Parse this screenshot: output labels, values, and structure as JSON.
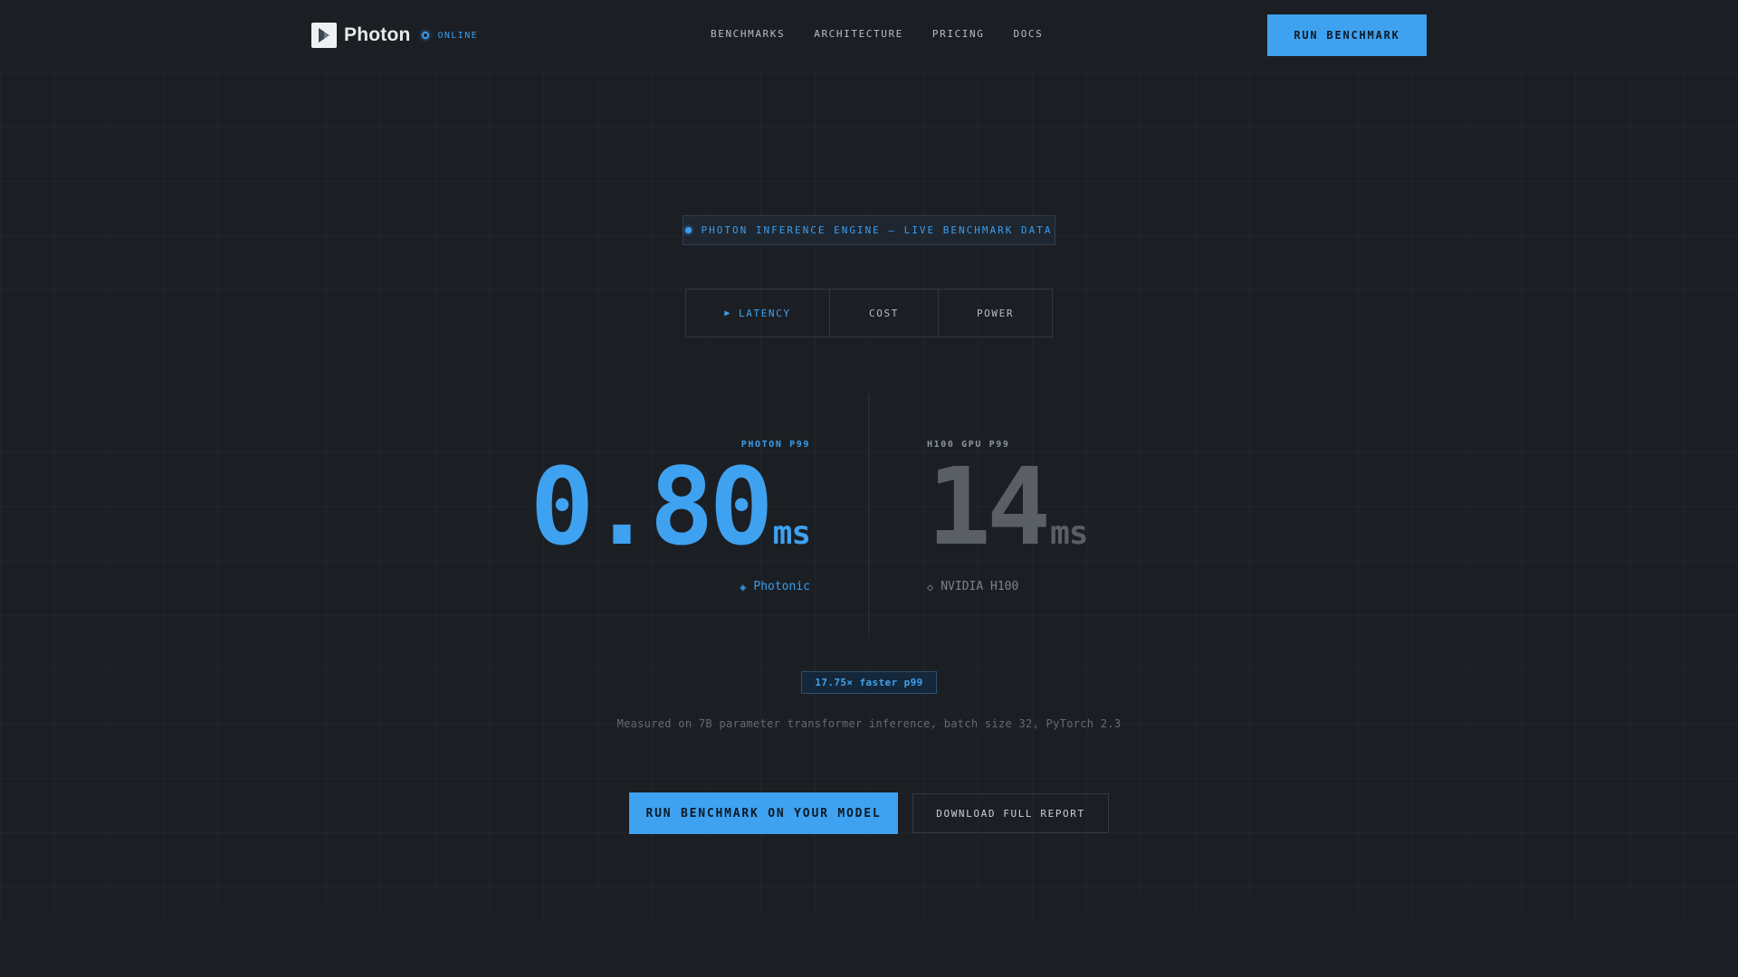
{
  "nav": {
    "brand": "Photon",
    "status": "ONLINE",
    "links": [
      "BENCHMARKS",
      "ARCHITECTURE",
      "PRICING",
      "DOCS"
    ],
    "cta": "RUN BENCHMARK"
  },
  "hero": {
    "badge": "PHOTON INFERENCE ENGINE — LIVE BENCHMARK DATA",
    "tabs": [
      "LATENCY",
      "COST",
      "POWER"
    ],
    "active_tab": "LATENCY"
  },
  "metrics": {
    "photon": {
      "label": "PHOTON P99",
      "value": "0.80",
      "unit": "ms",
      "source": "Photonic"
    },
    "gpu": {
      "label": "H100 GPU P99",
      "value": "14",
      "unit": "ms",
      "source": "NVIDIA H100"
    }
  },
  "speedup": "17.75× faster p99",
  "note": "Measured on 7B parameter transformer inference, batch size 32, PyTorch 2.3",
  "ctas": {
    "primary": "RUN BENCHMARK ON YOUR MODEL",
    "secondary": "DOWNLOAD FULL REPORT"
  },
  "colors": {
    "accent": "#3fa2f0",
    "background": "#1b1f24",
    "muted_value": "#5a5f66"
  },
  "icons": {
    "brand": "play-logo-icon",
    "status": "status-dot-icon",
    "active_tab": "play-arrow-icon",
    "photon_source": "diamond-filled-icon",
    "gpu_source": "diamond-outline-icon"
  }
}
